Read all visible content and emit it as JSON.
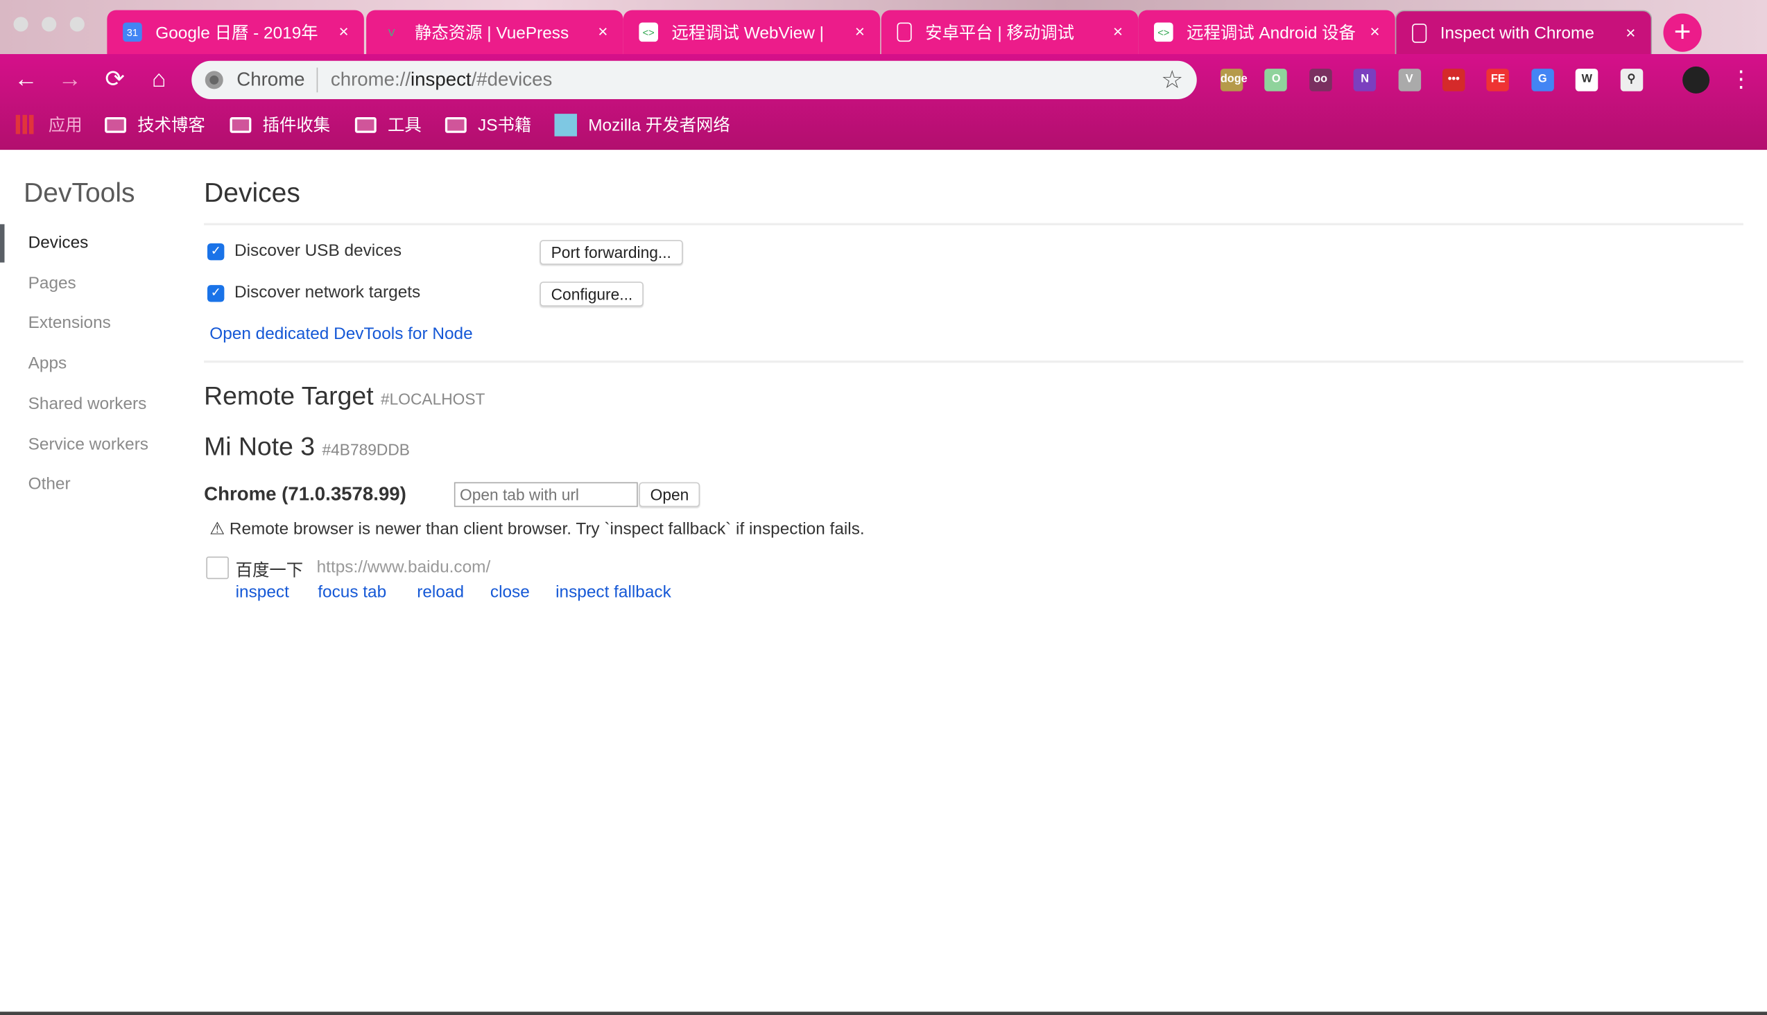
{
  "tabs": [
    {
      "title": "Google 日曆 - 2019年",
      "icon": "calendar-icon",
      "fav": "31"
    },
    {
      "title": "静态资源 | VuePress",
      "icon": "vue-icon",
      "fav": "V"
    },
    {
      "title": "远程调试 WebView | ",
      "icon": "chrome-devtools-icon",
      "fav": "<>"
    },
    {
      "title": "安卓平台 | 移动调试",
      "icon": "page-icon",
      "fav": ""
    },
    {
      "title": "远程调试 Android 设备",
      "icon": "chrome-devtools-icon",
      "fav": "<>"
    },
    {
      "title": "Inspect with Chrome",
      "icon": "page-icon",
      "fav": ""
    }
  ],
  "tab_close": "×",
  "new_tab": "+",
  "omnibox": {
    "site": "Chrome",
    "url_prefix": "chrome://",
    "url_host": "inspect",
    "url_rest": "/#devices"
  },
  "nav": {
    "back": "←",
    "forward": "→",
    "reload": "⟳",
    "home": "⌂",
    "star": "☆",
    "menu": "⋮"
  },
  "extensions": [
    "doge",
    "O",
    "oo",
    "N",
    "V",
    "•••",
    "FE",
    "G",
    "W",
    "⚲"
  ],
  "bookmarks": [
    {
      "label": "应用",
      "icon": "apps-grid-icon"
    },
    {
      "label": "技术博客",
      "icon": "folder-icon"
    },
    {
      "label": "插件收集",
      "icon": "folder-icon"
    },
    {
      "label": "工具",
      "icon": "folder-icon"
    },
    {
      "label": "JS书籍",
      "icon": "folder-icon"
    },
    {
      "label": "Mozilla 开发者网络",
      "icon": "mdn-icon"
    }
  ],
  "sidebar": {
    "title": "DevTools",
    "items": [
      "Devices",
      "Pages",
      "Extensions",
      "Apps",
      "Shared workers",
      "Service workers",
      "Other"
    ]
  },
  "main": {
    "title": "Devices",
    "discover_usb": "Discover USB devices",
    "port_forwarding": "Port forwarding...",
    "discover_network": "Discover network targets",
    "configure": "Configure...",
    "node_link": "Open dedicated DevTools for Node",
    "remote_target": "Remote Target",
    "remote_target_id": "#LOCALHOST",
    "device_name": "Mi Note 3",
    "device_id": "#4B789DDB",
    "browser": "Chrome (71.0.3578.99)",
    "open_tab_placeholder": "Open tab with url",
    "open": "Open",
    "warning": "⚠ Remote browser is newer than client browser. Try `inspect fallback` if inspection fails.",
    "page": {
      "title": "百度一下",
      "url": "https://www.baidu.com/",
      "actions": [
        "inspect",
        "focus tab",
        "reload",
        "close",
        "inspect fallback"
      ]
    }
  }
}
